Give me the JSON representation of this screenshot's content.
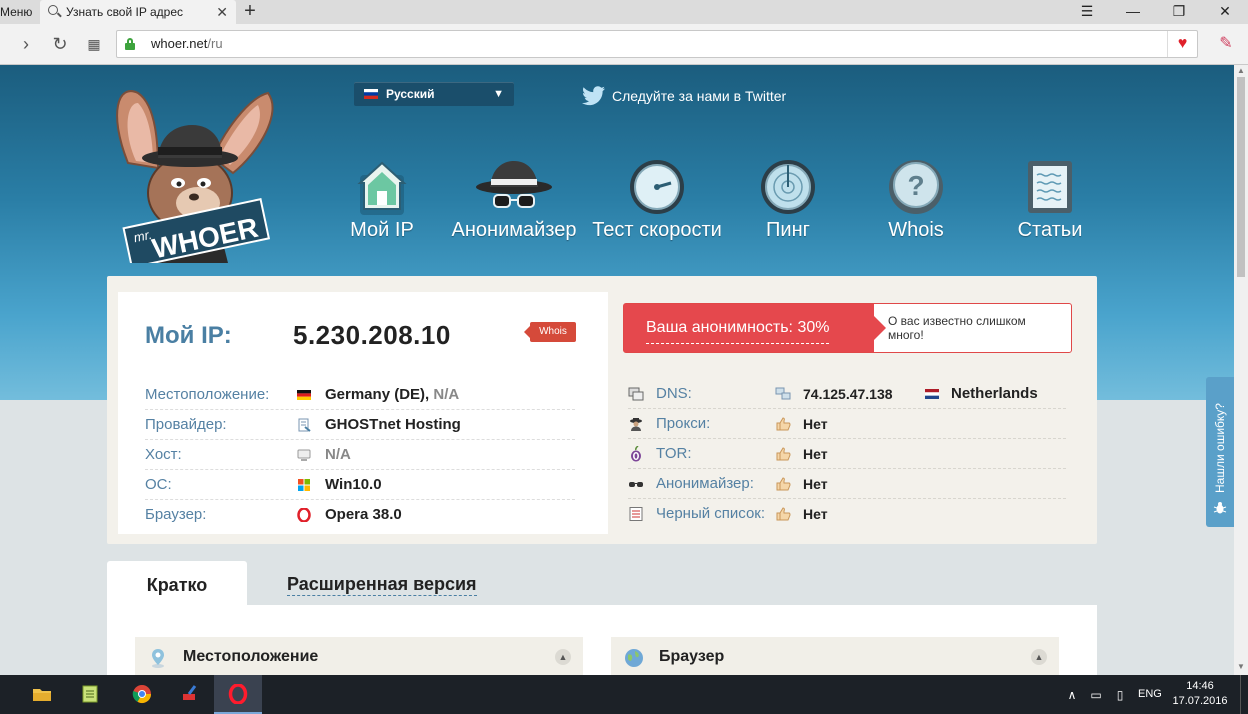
{
  "browser": {
    "menu_label": "Меню",
    "tab_title": "Узнать свой IP адрес",
    "url_host": "whoer.net",
    "url_path": "/ru"
  },
  "header": {
    "logo_small": "mr.",
    "logo_big": "WHOER",
    "language": "Русский",
    "twitter": "Следуйте за нами в Twitter",
    "nav": [
      {
        "label": "Мой IP",
        "icon": "house-icon"
      },
      {
        "label": "Анонимайзер",
        "icon": "spy-hat-icon"
      },
      {
        "label": "Тест скорости",
        "icon": "speedometer-icon"
      },
      {
        "label": "Пинг",
        "icon": "radar-icon"
      },
      {
        "label": "Whois",
        "icon": "question-icon"
      },
      {
        "label": "Статьи",
        "icon": "document-icon"
      }
    ]
  },
  "ipcard": {
    "my_ip_label": "Мой IP:",
    "my_ip_value": "5.230.208.10",
    "whois_badge": "Whois",
    "rows": [
      {
        "key": "Местоположение:",
        "value": "Germany (DE),",
        "muted": "N/A",
        "icon": "germany-flag-icon"
      },
      {
        "key": "Провайдер:",
        "value": "GHOSTnet Hosting",
        "muted": "",
        "icon": "provider-icon"
      },
      {
        "key": "Хост:",
        "value": "",
        "muted": "N/A",
        "icon": "host-icon"
      },
      {
        "key": "ОС:",
        "value": "Win10.0",
        "muted": "",
        "icon": "windows-icon"
      },
      {
        "key": "Браузер:",
        "value": "Opera 38.0",
        "muted": "",
        "icon": "opera-icon"
      }
    ],
    "anonymity_label": "Ваша анонимность: 30%",
    "anonymity_percent": 30,
    "anonymity_note": "О вас известно слишком много!",
    "checks": [
      {
        "key": "DNS:",
        "value": "74.125.47.138",
        "country": "Netherlands",
        "icon": "dns-icon"
      },
      {
        "key": "Прокси:",
        "value": "Нет",
        "icon": "proxy-icon"
      },
      {
        "key": "TOR:",
        "value": "Нет",
        "icon": "tor-onion-icon"
      },
      {
        "key": "Анонимайзер:",
        "value": "Нет",
        "icon": "anonymizer-icon"
      },
      {
        "key": "Черный список:",
        "value": "Нет",
        "icon": "blacklist-icon"
      }
    ]
  },
  "tabs": {
    "short": "Кратко",
    "extended": "Расширенная версия"
  },
  "panels": {
    "location": "Местоположение",
    "browser": "Браузер"
  },
  "feedback": "Нашли ошибку?",
  "taskbar": {
    "lang": "ENG",
    "time": "14:46",
    "date": "17.07.2016"
  },
  "colors": {
    "accent_blue": "#4a7fa3",
    "alert_red": "#e5484d"
  }
}
